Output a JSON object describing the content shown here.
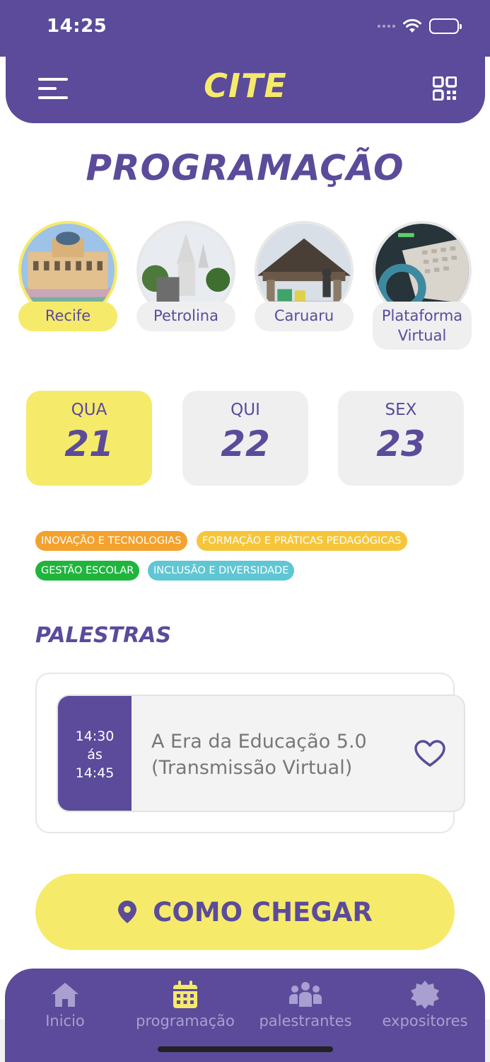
{
  "status_bar": {
    "time": "14:25"
  },
  "header": {
    "title": "CITE",
    "menu_icon": "hamburger-menu-icon",
    "qr_icon": "qr-code-icon"
  },
  "page": {
    "title": "PROGRAMAÇÃO"
  },
  "cities": [
    {
      "label": "Recife",
      "selected": true
    },
    {
      "label": "Petrolina",
      "selected": false
    },
    {
      "label": "Caruaru",
      "selected": false
    },
    {
      "label": "Plataforma Virtual",
      "selected": false
    }
  ],
  "days": [
    {
      "weekday": "QUA",
      "number": "21",
      "selected": true
    },
    {
      "weekday": "QUI",
      "number": "22",
      "selected": false
    },
    {
      "weekday": "SEX",
      "number": "23",
      "selected": false
    }
  ],
  "tags": [
    {
      "label": "INOVAÇÃO E TECNOLOGIAS",
      "color": "#f4a12e"
    },
    {
      "label": "FORMAÇÃO E PRÁTICAS PEDAGÓGICAS",
      "color": "#f6c53a"
    },
    {
      "label": "GESTÃO ESCOLAR",
      "color": "#1fb53d"
    },
    {
      "label": "INCLUSÃO E DIVERSIDADE",
      "color": "#5fc6d4"
    }
  ],
  "palestras": {
    "section_title": "PALESTRAS",
    "items": [
      {
        "start": "14:30",
        "sep": "ás",
        "end": "14:45",
        "title": "A Era da Educação 5.0 (Transmissão Virtual)",
        "favorite_icon": "heart-outline-icon"
      }
    ]
  },
  "cta": {
    "label": "COMO CHEGAR",
    "icon": "map-pin-icon",
    "color": "#f6ea6a"
  },
  "bottom_nav": [
    {
      "label": "Inicio",
      "icon": "home-icon",
      "active": false
    },
    {
      "label": "programação",
      "icon": "calendar-icon",
      "active": true
    },
    {
      "label": "palestrantes",
      "icon": "people-icon",
      "active": false
    },
    {
      "label": "expositores",
      "icon": "badge-icon",
      "active": false
    }
  ],
  "colors": {
    "primary": "#5b4b9a",
    "accent": "#f6ea6a",
    "inactive": "#a99fd0"
  }
}
